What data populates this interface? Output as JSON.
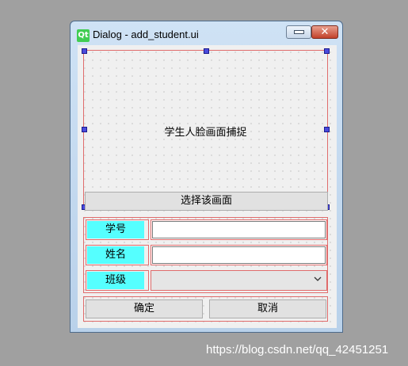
{
  "window": {
    "title": "Dialog - add_student.ui",
    "icon_text": "Qt",
    "close_glyph": "✕"
  },
  "capture": {
    "label": "学生人脸画面捕捉",
    "select_button": "选择该画面"
  },
  "form": {
    "rows": [
      {
        "label": "学号",
        "value": ""
      },
      {
        "label": "姓名",
        "value": ""
      },
      {
        "label": "班级",
        "value": ""
      }
    ]
  },
  "actions": {
    "ok": "确定",
    "cancel": "取消"
  },
  "watermark": "https://blog.csdn.net/qq_42451251"
}
